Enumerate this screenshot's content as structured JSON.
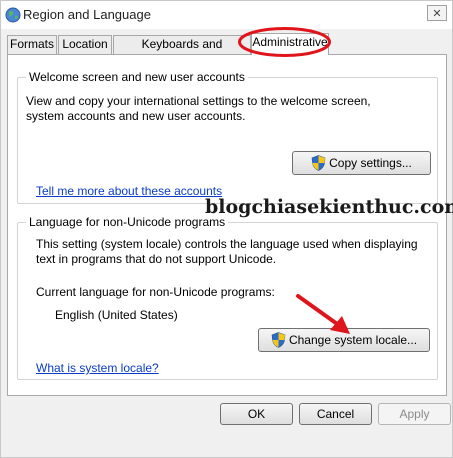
{
  "window": {
    "title": "Region and Language",
    "close_symbol": "✕"
  },
  "tabs": [
    {
      "label": "Formats",
      "active": false
    },
    {
      "label": "Location",
      "active": false
    },
    {
      "label": "Keyboards and Languages",
      "active": false
    },
    {
      "label": "Administrative",
      "active": true
    }
  ],
  "welcome_group": {
    "title": "Welcome screen and new user accounts",
    "description": "View and copy your international settings to the welcome screen, system accounts and new user accounts.",
    "copy_button": "Copy settings...",
    "link": "Tell me more about these accounts"
  },
  "unicode_group": {
    "title": "Language for non-Unicode programs",
    "description": "This setting (system locale) controls the language used when displaying text in programs that do not support Unicode.",
    "current_label": "Current language for non-Unicode programs:",
    "current_value": "English (United States)",
    "change_button": "Change system locale...",
    "link": "What is system locale?"
  },
  "watermark": "blogchiasekienthuc.com",
  "footer": {
    "ok": "OK",
    "cancel": "Cancel",
    "apply": "Apply"
  },
  "icons": {
    "app": "globe-icon",
    "uac": "shield-icon",
    "annotation_color": "#e0151b"
  }
}
